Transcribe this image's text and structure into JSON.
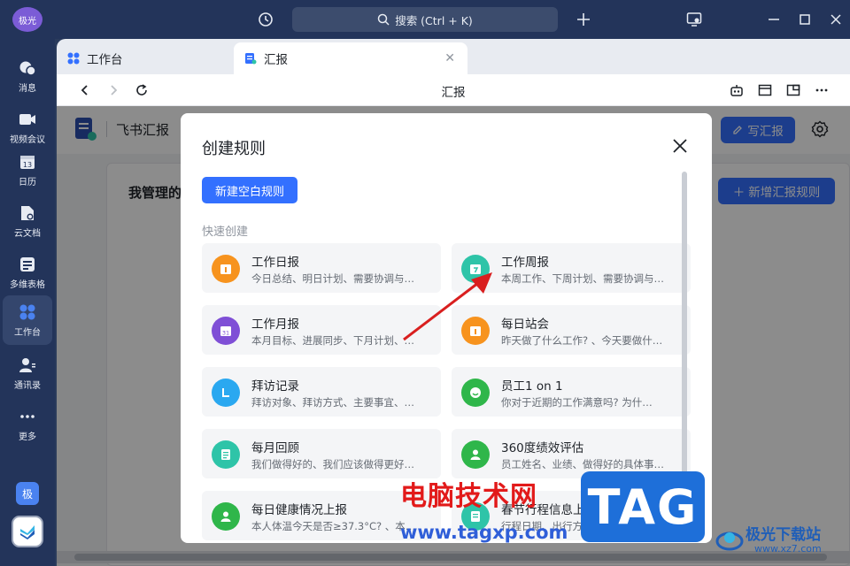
{
  "rail": {
    "avatar": "极光",
    "items": [
      {
        "label": "消息",
        "icon": "message-icon"
      },
      {
        "label": "视频会议",
        "icon": "video-icon"
      },
      {
        "label": "日历",
        "icon": "calendar-icon"
      },
      {
        "label": "云文档",
        "icon": "doc-icon"
      },
      {
        "label": "多维表格",
        "icon": "table-icon"
      },
      {
        "label": "工作台",
        "icon": "workbench-icon"
      },
      {
        "label": "通讯录",
        "icon": "contacts-icon"
      },
      {
        "label": "更多",
        "icon": "more-icon"
      }
    ],
    "badge": "极"
  },
  "titlebar": {
    "search_placeholder": "搜索 (Ctrl + K)"
  },
  "tabs": [
    {
      "label": "工作台"
    },
    {
      "label": "汇报"
    }
  ],
  "nav": {
    "title": "汇报"
  },
  "app": {
    "brand": "飞书汇报",
    "write_button": "写汇报",
    "card_title": "我管理的",
    "add_rule_button": "新增汇报规则"
  },
  "modal": {
    "title": "创建规则",
    "new_blank_button": "新建空白规则",
    "quick_create_label": "快速创建",
    "templates": [
      {
        "name": "工作日报",
        "desc": "今日总结、明日计划、需要协调与…",
        "color": "#f7931e",
        "icon": "daily-report-icon"
      },
      {
        "name": "工作周报",
        "desc": "本周工作、下周计划、需要协调与…",
        "color": "#2ec4a8",
        "icon": "weekly-report-icon"
      },
      {
        "name": "工作月报",
        "desc": "本月目标、进展同步、下月计划、…",
        "color": "#7f4fd6",
        "icon": "monthly-report-icon"
      },
      {
        "name": "每日站会",
        "desc": "昨天做了什么工作? 、今天要做什…",
        "color": "#f7931e",
        "icon": "standup-icon"
      },
      {
        "name": "拜访记录",
        "desc": "拜访对象、拜访方式、主要事宜、…",
        "color": "#2aa8f0",
        "icon": "visit-icon"
      },
      {
        "name": "员工1 on 1",
        "desc": "你对于近期的工作满意吗? 为什…",
        "color": "#2fb64a",
        "icon": "one-on-one-icon"
      },
      {
        "name": "每月回顾",
        "desc": "我们做得好的、我们应该做得更好…",
        "color": "#2ec4a8",
        "icon": "review-icon"
      },
      {
        "name": "360度绩效评估",
        "desc": "员工姓名、业绩、做得好的具体事…",
        "color": "#2fb64a",
        "icon": "performance-icon"
      },
      {
        "name": "每日健康情况上报",
        "desc": "本人体温今天是否≥37.3°C? 、本…",
        "color": "#2fb64a",
        "icon": "health-icon"
      },
      {
        "name": "春节行程信息上报",
        "desc": "行程日期、出行方式、出发地点…",
        "color": "#2ec4a8",
        "icon": "trip-icon"
      }
    ]
  },
  "watermarks": {
    "site_cn": "电脑技术网",
    "site_url": "www.tagxp.com",
    "tag": "TAG",
    "jg_name": "极光下载站",
    "jg_url": "www.xz7.com"
  },
  "colors": {
    "accent": "#3370ff",
    "rail": "#23345a"
  }
}
